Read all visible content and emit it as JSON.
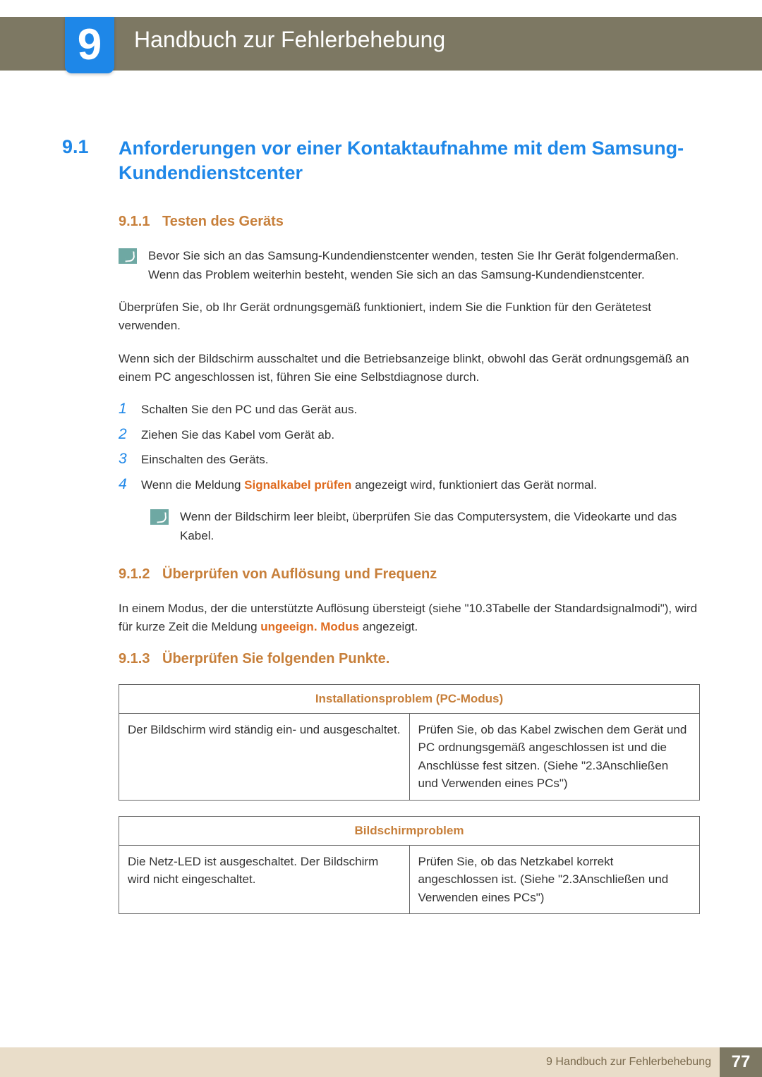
{
  "chapter": {
    "number": "9",
    "title": "Handbuch zur Fehlerbehebung"
  },
  "section": {
    "num": "9.1",
    "title": "Anforderungen vor einer Kontaktaufnahme mit dem Samsung-Kundendienstcenter"
  },
  "sub1": {
    "num": "9.1.1",
    "title": "Testen des Geräts",
    "note": "Bevor Sie sich an das Samsung-Kundendienstcenter wenden, testen Sie Ihr Gerät folgendermaßen. Wenn das Problem weiterhin besteht, wenden Sie sich an das Samsung-Kundendienstcenter.",
    "p1": "Überprüfen Sie, ob Ihr Gerät ordnungsgemäß funktioniert, indem Sie die Funktion für den Gerätetest verwenden.",
    "p2": "Wenn sich der Bildschirm ausschaltet und die Betriebsanzeige blinkt, obwohl das Gerät ordnungsgemäß an einem PC angeschlossen ist, führen Sie eine Selbstdiagnose durch.",
    "steps": [
      "Schalten Sie den PC und das Gerät aus.",
      "Ziehen Sie das Kabel vom Gerät ab.",
      "Einschalten des Geräts."
    ],
    "step4_prefix": "Wenn die Meldung ",
    "step4_bold": "Signalkabel prüfen",
    "step4_suffix": " angezeigt wird, funktioniert das Gerät normal.",
    "subnote": "Wenn der Bildschirm leer bleibt, überprüfen Sie das Computersystem, die Videokarte und das Kabel."
  },
  "sub2": {
    "num": "9.1.2",
    "title": "Überprüfen von Auflösung und Frequenz",
    "p_prefix": "In einem Modus, der die unterstützte Auflösung übersteigt (siehe \"10.3Tabelle der Standardsignalmodi\"), wird für kurze Zeit die Meldung ",
    "p_bold": "ungeeign. Modus",
    "p_suffix": " angezeigt."
  },
  "sub3": {
    "num": "9.1.3",
    "title": "Überprüfen Sie folgenden Punkte.",
    "table1": {
      "header": "Installationsproblem (PC-Modus)",
      "left": "Der Bildschirm wird ständig ein- und ausgeschaltet.",
      "right": "Prüfen Sie, ob das Kabel zwischen dem Gerät und PC ordnungsgemäß angeschlossen ist und die Anschlüsse fest sitzen. (Siehe \"2.3Anschließen und Verwenden eines PCs\")"
    },
    "table2": {
      "header": "Bildschirmproblem",
      "left": "Die Netz-LED ist ausgeschaltet. Der Bildschirm wird nicht eingeschaltet.",
      "right": "Prüfen Sie, ob das Netzkabel korrekt angeschlossen ist. (Siehe \"2.3Anschließen und Verwenden eines PCs\")"
    }
  },
  "footer": {
    "text": "9 Handbuch zur Fehlerbehebung",
    "page": "77"
  }
}
